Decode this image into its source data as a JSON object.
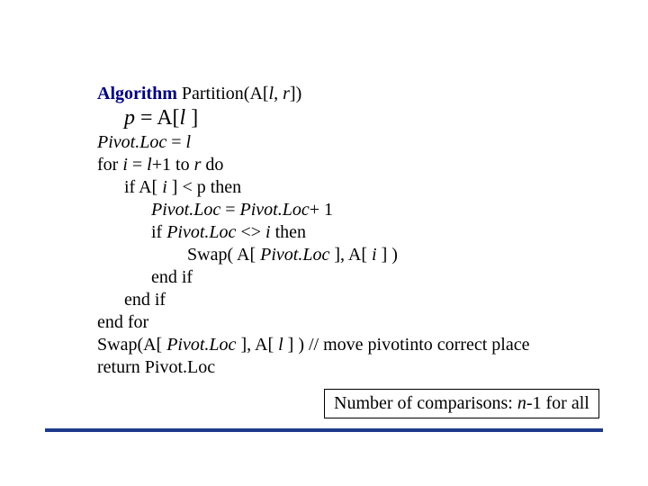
{
  "algo": {
    "title_prefix": "Algorithm",
    "title_rest": " Partition(A[",
    "title_l": "l",
    "title_sep": ", ",
    "title_r": "r",
    "title_close": "])",
    "p_assign_lhs": "p",
    "p_assign_eq": " = A[",
    "p_assign_l": "l",
    "p_assign_close": " ]",
    "pivotloc_lhs": "Pivot.Loc",
    "pivotloc_eq": " = ",
    "pivotloc_rhs": "l",
    "for_kw": "for ",
    "for_var": "i",
    "for_eq": " = ",
    "for_l": "l",
    "for_plus1": "+1 to ",
    "for_r": "r",
    "for_do": " do",
    "if1_kw": "if A[ ",
    "if1_i": "i",
    "if1_rest": " ] < p then",
    "inc_lhs": "Pivot.Loc",
    "inc_eq": " = ",
    "inc_rhs": "Pivot.Loc",
    "inc_plus": "+ 1",
    "if2_kw": "if ",
    "if2_lhs": "Pivot.Loc",
    "if2_ne": " <> ",
    "if2_i": "i",
    "if2_then": " then",
    "swap1_pre": "Swap( A[ ",
    "swap1_a": "Pivot.Loc",
    "swap1_mid": " ], A[ ",
    "swap1_i": "i",
    "swap1_close": " ] )",
    "endif1": "end if",
    "endif2": "end if",
    "endfor": "end for",
    "swap2_pre": "Swap(A[ ",
    "swap2_a": "Pivot.Loc",
    "swap2_mid": " ], A[ ",
    "swap2_l": "l",
    "swap2_close": " ] ) // move pivot",
    "swap2_tail": "into correct place",
    "return_kw": "return ",
    "return_val": "Pivot.Loc"
  },
  "footnote": {
    "prefix": "Number of comparisons: ",
    "n": "n",
    "suffix": "-1 for all"
  }
}
